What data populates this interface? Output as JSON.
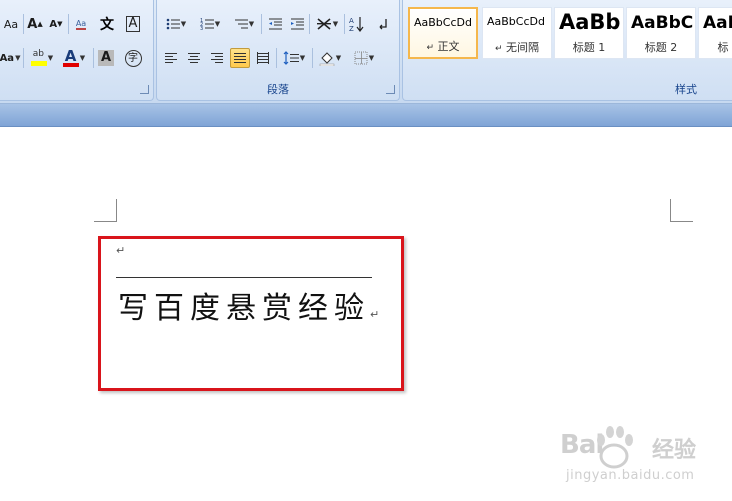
{
  "ribbon": {
    "font_group": {
      "aa_button": "Aa",
      "grow_font": "A",
      "shrink_font": "A",
      "clear_format": "Aa",
      "phonetic": "文",
      "char_border": "A",
      "highlight": "ab",
      "font_color": "A",
      "char_shading": "A",
      "enclose_char": "字"
    },
    "paragraph_group": {
      "label": "段落"
    },
    "styles_group": {
      "label": "样式",
      "tiles": [
        {
          "sample": "AaBbCcDd",
          "name": "正文",
          "mark": "↵"
        },
        {
          "sample": "AaBbCcDd",
          "name": "无间隔",
          "mark": "↵"
        },
        {
          "sample": "AaBb",
          "name": "标题 1",
          "mark": ""
        },
        {
          "sample": "AaBbC",
          "name": "标题 2",
          "mark": ""
        },
        {
          "sample": "AaB",
          "name": "标",
          "mark": ""
        }
      ]
    },
    "colors": {
      "highlight": "#ffff00",
      "font_color": "#e00000"
    }
  },
  "document": {
    "text": "写百度悬赏经验",
    "paragraph_mark": "↵",
    "highlight_border_color": "#d9141b"
  },
  "watermark": {
    "brand": "Bai",
    "product": "经验",
    "url": "jingyan.baidu.com"
  }
}
